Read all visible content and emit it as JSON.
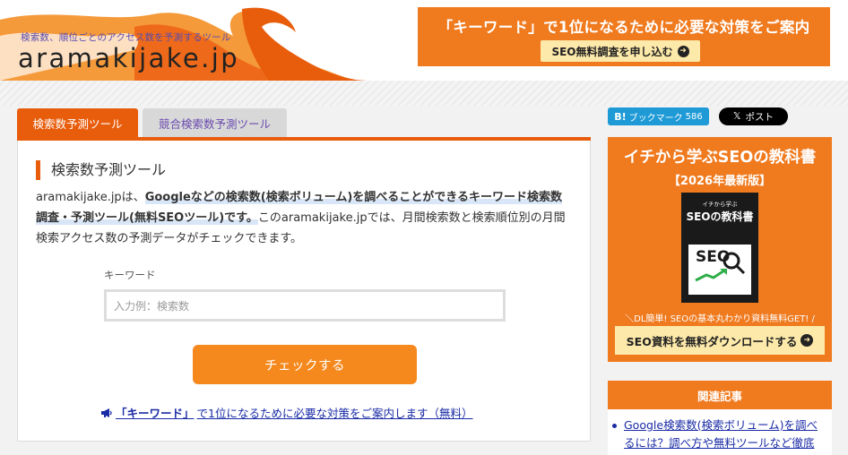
{
  "header": {
    "tagline": "検索数、順位ごとのアクセス数を予測するツール",
    "logo": "aramakijake.jp",
    "banner": {
      "headline": "「キーワード」で1位になるために必要な対策をご案内",
      "button": "SEO無料調査を申し込む"
    }
  },
  "tabs": [
    {
      "label": "検索数予測ツール",
      "active": true
    },
    {
      "label": "競合検索数予測ツール",
      "active": false
    }
  ],
  "main": {
    "section_title": "検索数予測ツール",
    "intro_lead": "aramakijake.jpは、",
    "intro_highlight": "Googleなどの検索数(検索ボリューム)を調べることができるキーワード検索数調査・予測ツール(無料SEOツール)です。",
    "intro_rest": "このaramakijake.jpでは、月間検索数と検索順位別の月間検索アクセス数の予測データがチェックできます。",
    "keyword_label": "キーワード",
    "keyword_placeholder": "入力例：検索数",
    "check_button": "チェックする",
    "promo_link_keyword": "「キーワード」",
    "promo_link_rest": "で1位になるために必要な対策をご案内します（無料）"
  },
  "sidebar": {
    "hatena": {
      "label": "ブックマーク",
      "count": "586"
    },
    "x_post": "ポスト",
    "ebook": {
      "title": "イチから学ぶSEOの教科書",
      "edition": "【2026年最新版】",
      "book_top": "イチから学ぶ",
      "book_name": "SEOの教科書",
      "book_card": "SEO",
      "note": "＼DL簡単! SEOの基本丸わかり資料無料GET! /",
      "button": "SEO資料を無料ダウンロードする"
    },
    "related_heading": "関連記事",
    "related_items": [
      "Google検索数(検索ボリューム)を調べるには？調べ方や無料ツールなど徹底"
    ]
  },
  "colors": {
    "accent": "#e85d0c",
    "banner": "#f07a1e",
    "button": "#f5891e",
    "link": "#1a2ba6"
  }
}
